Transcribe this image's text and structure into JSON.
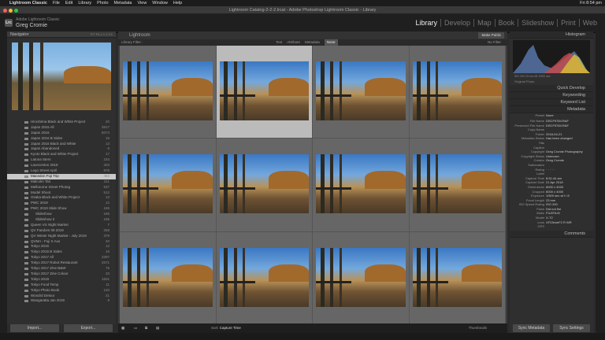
{
  "menubar": {
    "app": "Lightroom Classic",
    "items": [
      "File",
      "Edit",
      "Library",
      "Photo",
      "Metadata",
      "View",
      "Window",
      "Help"
    ],
    "clock": "Fri 8:54 pm"
  },
  "window": {
    "title": "Lightroom Catalog-2-2-2.lrcat - Adobe Photoshop Lightroom Classic - Library"
  },
  "identity": {
    "app_label": "Adobe Lightroom Classic",
    "user": "Greg Cromie",
    "logo": "Lrc"
  },
  "modules": [
    "Library",
    "Develop",
    "Map",
    "Book",
    "Slideshow",
    "Print",
    "Web"
  ],
  "navigator": {
    "title": "Navigator",
    "options": "FIT  FILL  1:1  3:1"
  },
  "folders": [
    {
      "name": "Hiroshima Black and White Project",
      "count": "20"
    },
    {
      "name": "Japan 2015 All",
      "count": "3817"
    },
    {
      "name": "Japan 2016",
      "count": "6074"
    },
    {
      "name": "Japan 2016 B Sides",
      "count": "15"
    },
    {
      "name": "Japan 2016 Black and White",
      "count": "13"
    },
    {
      "name": "Japan Abandoned",
      "count": "8"
    },
    {
      "name": "Kyoto Black and White Project",
      "count": "17"
    },
    {
      "name": "Latona Sters",
      "count": "153"
    },
    {
      "name": "Launceston 2018",
      "count": "403"
    },
    {
      "name": "Lego Street April",
      "count": "878"
    },
    {
      "name": "Macedon Fuji Trip",
      "count": "482",
      "selected": true
    },
    {
      "name": "Malcolm Tait",
      "count": "211"
    },
    {
      "name": "Melbourne Street Photog",
      "count": "537"
    },
    {
      "name": "Model Shoot",
      "count": "512"
    },
    {
      "name": "Osaka Black and White Project",
      "count": "13"
    },
    {
      "name": "PWC 2019",
      "count": "12"
    },
    {
      "name": "PWC 2019 Slide Show",
      "count": "185"
    },
    {
      "name": "Slideshow",
      "count": "185",
      "sub": true
    },
    {
      "name": "Slideshow 2",
      "count": "185",
      "sub": true
    },
    {
      "name": "Queen Vic Night Market",
      "count": "7"
    },
    {
      "name": "QV Fandom 08 2019",
      "count": "268"
    },
    {
      "name": "QV Winter Night Market - July 2019",
      "count": "379"
    },
    {
      "name": "QVMA - Fuji X Aus",
      "count": "40"
    },
    {
      "name": "Tokyo 2015",
      "count": "12"
    },
    {
      "name": "Tokyo 2015 B Sides",
      "count": "16"
    },
    {
      "name": "Tokyo 2017 All",
      "count": "3397"
    },
    {
      "name": "Tokyo 2017 Robot Restaurant",
      "count": "2671"
    },
    {
      "name": "Tokyo 2017 Zine B&W",
      "count": "76"
    },
    {
      "name": "Tokyo 2017 Zine Colour",
      "count": "33"
    },
    {
      "name": "Tokyo 2019",
      "count": "1501"
    },
    {
      "name": "Tokyo Food Temp",
      "count": "11"
    },
    {
      "name": "Tokyo Photo Book",
      "count": "120"
    },
    {
      "name": "Wondrd Detour",
      "count": "21"
    },
    {
      "name": "Wangaratta Jan 2019",
      "count": "8"
    }
  ],
  "left_buttons": {
    "import": "Import...",
    "export": "Export..."
  },
  "center": {
    "title": "Lightroom",
    "make_public": "Make Public",
    "filter_label": "Library Filter :",
    "filter_opts": [
      "Text",
      "Attribute",
      "Metadata",
      "None"
    ],
    "filter_active": "None",
    "no_filter": "No Filter"
  },
  "toolbar": {
    "sort_label": "Sort:",
    "sort_value": "Capture Time",
    "thumbnails_label": "Thumbnails"
  },
  "right": {
    "histogram": "Histogram",
    "histogram_info": "ISO 200    23 mm    f/8    1/500 sec",
    "original_photo": "Original Photo",
    "quick_develop": "Quick Develop",
    "keywording": "Keywording",
    "keyword_list": "Keyword List",
    "metadata": "Metadata",
    "preset_label": "Preset",
    "preset_value": "None",
    "comments": "Comments"
  },
  "metadata_rows": [
    {
      "k": "File Name",
      "v": "DSCF9784.RAF"
    },
    {
      "k": "Preserved File Name",
      "v": "DSCF9784.RAF"
    },
    {
      "k": "Copy Name",
      "v": ""
    },
    {
      "k": "Folder",
      "v": "2018-04-21"
    },
    {
      "k": "Metadata Status",
      "v": "Has been changed"
    },
    {
      "k": "Title",
      "v": ""
    },
    {
      "k": "Caption",
      "v": ""
    },
    {
      "k": "Copyright",
      "v": "Greg Cromie Photography"
    },
    {
      "k": "Copyright Status",
      "v": "Unknown"
    },
    {
      "k": "Creator",
      "v": "Greg Cromie"
    },
    {
      "k": "Sublocation",
      "v": ""
    },
    {
      "k": "Rating",
      "v": "· · · · ·"
    },
    {
      "k": "Label",
      "v": ""
    },
    {
      "k": "Capture Time",
      "v": "8:51:44 am"
    },
    {
      "k": "Capture Date",
      "v": "21 Apr 2018"
    },
    {
      "k": "Dimensions",
      "v": "6000 x 4000"
    },
    {
      "k": "Cropped",
      "v": "6000 x 4000"
    },
    {
      "k": "Exposure",
      "v": "1/500 sec at f / 8"
    },
    {
      "k": "Focal Length",
      "v": "23 mm"
    },
    {
      "k": "ISO Speed Rating",
      "v": "ISO 200"
    },
    {
      "k": "Flash",
      "v": "Did not fire"
    },
    {
      "k": "Make",
      "v": "FUJIFILM"
    },
    {
      "k": "Model",
      "v": "X-T2"
    },
    {
      "k": "Lens",
      "v": "XF23mmF2 R WR"
    },
    {
      "k": "GPS",
      "v": ""
    }
  ],
  "right_buttons": {
    "sync": "Sync Metadata",
    "sync_settings": "Sync Settings"
  }
}
